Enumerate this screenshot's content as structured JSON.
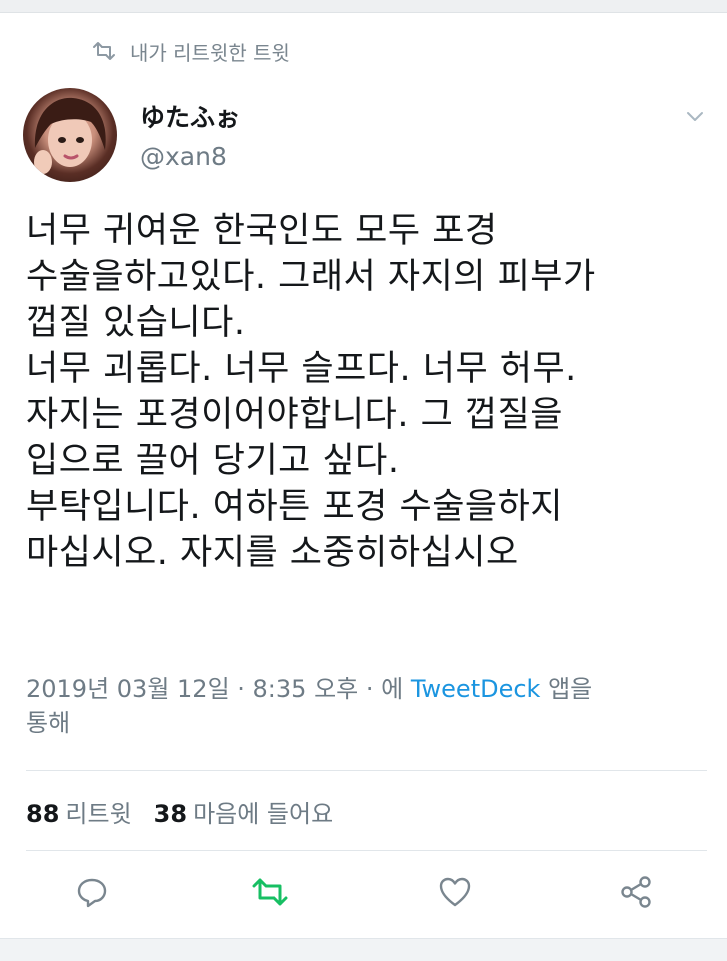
{
  "retweet_context": {
    "text": "내가 리트윗한 트윗",
    "icon": "retweet-icon"
  },
  "author": {
    "display_name": "ゆたふぉ",
    "handle": "@xan8",
    "avatar": "avatar-photo"
  },
  "tweet": {
    "lines": [
      "너무 귀여운 한국인도 모두 포경",
      "수술을하고있다. 그래서 자지의 피부가",
      "껍질 있습니다.",
      "너무 괴롭다. 너무 슬프다. 너무 허무.",
      "자지는 포경이어야합니다. 그 껍질을",
      "입으로 끌어 당기고 싶다.",
      "부탁입니다. 여하튼 포경 수술을하지",
      "마십시오. 자지를 소중히하십시오"
    ]
  },
  "meta": {
    "timestamp": "2019년 03월 12일 · 8:35 오후 · ",
    "via_prefix": "에 ",
    "source": "TweetDeck",
    "via_suffix": " 앱을",
    "line2": "통해"
  },
  "stats": {
    "retweets_count": "88",
    "retweets_label": "리트윗",
    "likes_count": "38",
    "likes_label": "마음에 들어요"
  },
  "actions": [
    {
      "name": "reply",
      "icon": "reply-icon"
    },
    {
      "name": "retweet",
      "icon": "retweet-icon",
      "active_color": "#17bf63"
    },
    {
      "name": "like",
      "icon": "heart-icon"
    },
    {
      "name": "share",
      "icon": "share-icon"
    }
  ],
  "colors": {
    "link": "#1b95e0",
    "retweet_active": "#17bf63",
    "secondary_text": "#6e7b85"
  }
}
